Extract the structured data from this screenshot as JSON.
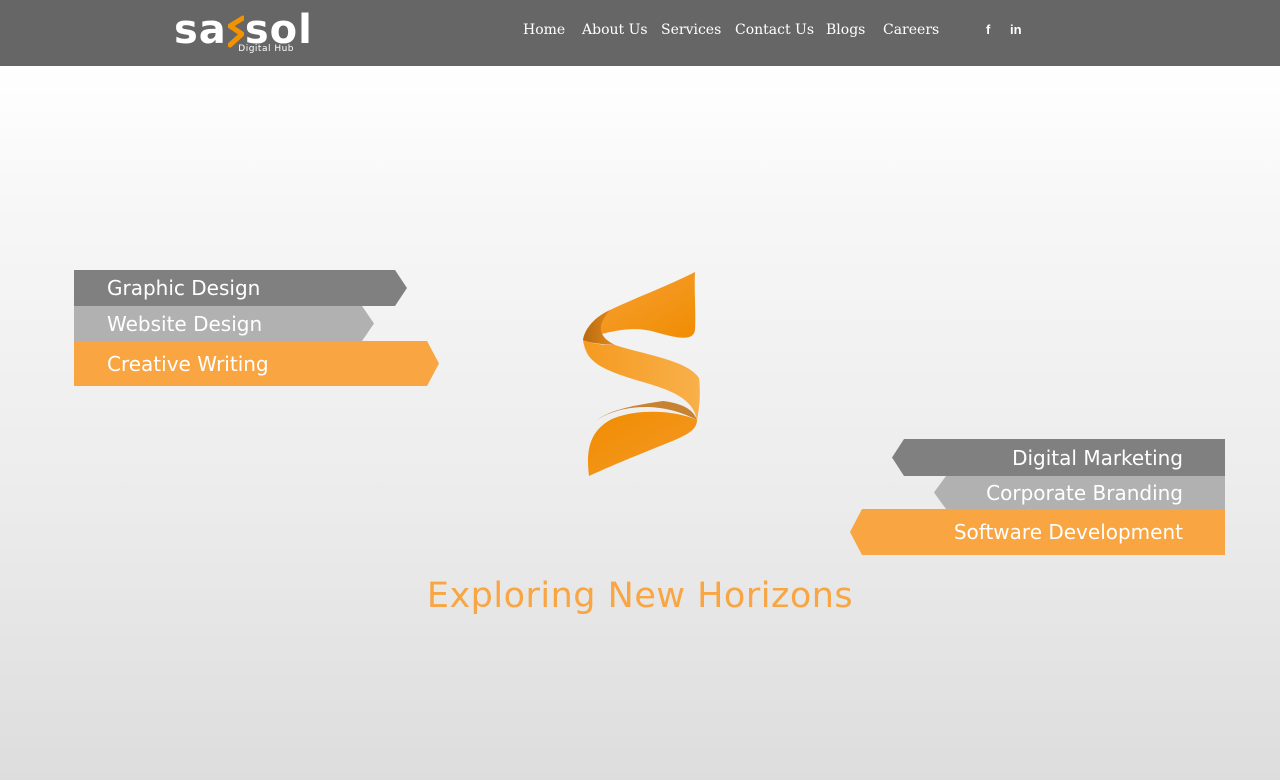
{
  "header": {
    "logo": {
      "word_left": "sa",
      "word_right": "sol",
      "subtitle": "Digital Hub"
    },
    "nav": [
      {
        "label": "Home"
      },
      {
        "label": "About Us"
      },
      {
        "label": "Services"
      },
      {
        "label": "Contact Us"
      },
      {
        "label": "Blogs"
      },
      {
        "label": "Careers"
      }
    ],
    "social": [
      {
        "icon": "facebook-icon",
        "glyph": "f"
      },
      {
        "icon": "linkedin-icon",
        "glyph": "in"
      }
    ]
  },
  "hero": {
    "left_services": [
      {
        "label": "Graphic Design",
        "color": "#808080"
      },
      {
        "label": "Website Design",
        "color": "#b1b1b1"
      },
      {
        "label": "Creative Writing",
        "color": "#f8a542"
      }
    ],
    "right_services": [
      {
        "label": "Digital Marketing",
        "color": "#808080"
      },
      {
        "label": "Corporate Branding",
        "color": "#b1b1b1"
      },
      {
        "label": "Software Development",
        "color": "#f8a542"
      }
    ],
    "emblem_icon": "s-ribbon-logo-icon",
    "tagline": "Exploring New Horizons"
  },
  "colors": {
    "header_bg": "#666666",
    "accent": "#f8a542",
    "ribbon_dark": "#808080",
    "ribbon_light": "#b1b1b1"
  }
}
